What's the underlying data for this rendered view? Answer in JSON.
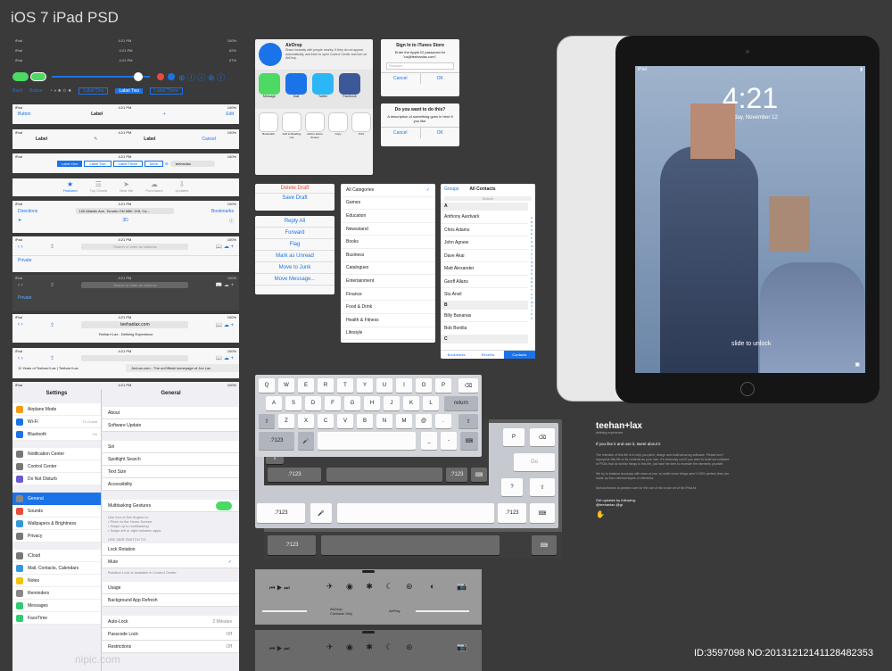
{
  "title": "iOS 7 iPad PSD",
  "status": {
    "carrier": "iPad",
    "time": "4:21 PM",
    "battery": "100%",
    "batteryB": "62%",
    "batteryC": "57%"
  },
  "nav1": {
    "back": "Back",
    "button": "Button",
    "seg": [
      "Label One",
      "Label Two",
      "Label Three"
    ]
  },
  "bar1": {
    "left": "Button",
    "center": "Label",
    "right": "Edit"
  },
  "bar2": {
    "label": "Label",
    "cancel": "Cancel"
  },
  "bar3": {
    "seg": [
      "Label One",
      "Label Two",
      "Label Three",
      "More"
    ],
    "search": "teehanlax"
  },
  "tabs": [
    "Featured",
    "Top Charts",
    "Near Me",
    "Purchased",
    "Updates"
  ],
  "maps": {
    "left": "Directions",
    "field": "100 Atlantic Ave, Toronto ON M6K 1X8, Ca...",
    "right": "Bookmarks",
    "mode": "3D"
  },
  "safari": {
    "placeholder": "Search or enter an address",
    "private": "Private",
    "domain": "teehanlax.com",
    "sitetitle": "Teehan+Lax : Defining Experience",
    "tab1": "11 Years of Teehan+Lax | Teehan+Lax",
    "tab2": "JonLax.com - The unOfficial homepage of Jon Lax"
  },
  "settings": {
    "title": "Settings",
    "items": [
      {
        "label": "Airplane Mode",
        "color": "#f39c12"
      },
      {
        "label": "Wi-Fi",
        "value": "TL-Guest",
        "color": "#1a73e8"
      },
      {
        "label": "Bluetooth",
        "value": "On",
        "color": "#1a73e8"
      },
      {
        "label": "Notification Center",
        "color": "#777"
      },
      {
        "label": "Control Center",
        "color": "#777"
      },
      {
        "label": "Do Not Disturb",
        "color": "#6a5acd"
      },
      {
        "label": "General",
        "color": "#888"
      },
      {
        "label": "Sounds",
        "color": "#e74c3c"
      },
      {
        "label": "Wallpapers & Brightness",
        "color": "#3498db"
      },
      {
        "label": "Privacy",
        "color": "#777"
      },
      {
        "label": "iCloud",
        "color": "#777"
      },
      {
        "label": "Mail, Contacts, Calendars",
        "color": "#3498db"
      },
      {
        "label": "Notes",
        "color": "#f1c40f"
      },
      {
        "label": "Reminders",
        "color": "#888"
      },
      {
        "label": "Messages",
        "color": "#2ecc71"
      },
      {
        "label": "FaceTime",
        "color": "#2ecc71"
      }
    ]
  },
  "general": {
    "title": "General",
    "about": "About",
    "update": "Software Update",
    "siri": "Siri",
    "spotlight": "Spotlight Search",
    "textsize": "Text Size",
    "access": "Accessibility",
    "multi": "Multitasking Gestures",
    "multidesc": [
      "Use four or five fingers to:",
      "• Pinch to the Home Screen",
      "• Swipe up to multitasking",
      "• Swipe left or right between apps"
    ],
    "sideswitch": "USE SIDE SWITCH TO:",
    "lock": "Lock Rotation",
    "mute": "Mute",
    "rotnote": "Rotation Lock is available in Control Center.",
    "usage": "Usage",
    "bgrefresh": "Background App Refresh",
    "autolock": "Auto-Lock",
    "autolockval": "2 Minutes",
    "passcode": "Passcode Lock",
    "passval": "Off",
    "restrict": "Restrictions",
    "restrictval": "Off"
  },
  "share": {
    "airdrop": "AirDrop",
    "airdesc": "Share instantly with people nearby. If they do not appear automatically, ask them to open Control Center and turn on AirDrop.",
    "apps": [
      "Message",
      "Mail",
      "Twitter",
      "Facebook"
    ],
    "acts": [
      "Bookmark",
      "Add to Reading List",
      "Add to Home Screen",
      "Copy",
      "Print"
    ]
  },
  "alert1": {
    "title": "Sign In to iTunes Store",
    "msg": "Enter the Apple ID password for \"us@teehanlax.com\".",
    "ph": "Password",
    "cancel": "Cancel",
    "ok": "OK"
  },
  "alert2": {
    "title": "Do you want to do this?",
    "msg": "A description of something goes in here if you like.",
    "cancel": "Cancel",
    "ok": "OK"
  },
  "draft": [
    "Delete Draft",
    "Save Draft"
  ],
  "mailact": [
    "Reply All",
    "Forward",
    "Flag",
    "Mark as Unread",
    "Move to Junk",
    "Move Message..."
  ],
  "cats": [
    "All Categories",
    "Games",
    "Education",
    "Newsstand",
    "Books",
    "Business",
    "Catalogues",
    "Entertainment",
    "Finance",
    "Food & Drink",
    "Health & Fitness",
    "Lifestyle"
  ],
  "contacts": {
    "groups": "Groups",
    "title": "All Contacts",
    "search": "Search",
    "rows": [
      "A",
      "Anthony Aardvark",
      "Chris Adams",
      "John Agnew",
      "Dave Akai",
      "Matt Alexander",
      "Geoff Allans",
      "Stu Anvil",
      "B",
      "Billy Bananas",
      "Bob Bonilla",
      "C"
    ],
    "tabs": [
      "Bookmarks",
      "Recents",
      "Contacts"
    ],
    "index": "A B C D E F G H I J K L M N O P Q R S T U V W X Y Z #"
  },
  "keyboard": {
    "r1": [
      "Q",
      "W",
      "E",
      "R",
      "T",
      "Y",
      "U",
      "I",
      "O",
      "P"
    ],
    "r2": [
      "A",
      "S",
      "D",
      "F",
      "G",
      "H",
      "J",
      "K",
      "L"
    ],
    "return": "return",
    "r3": [
      "Z",
      "X",
      "C",
      "V",
      "B",
      "N",
      "M",
      "@",
      "."
    ],
    "num": ".?123",
    "go": "Go",
    "num2": ".?123"
  },
  "cc": {
    "airdrop": "AirDrop:",
    "airdrop2": "Contacts Only",
    "airplay": "AirPlay"
  },
  "ipad": {
    "carrier": "iPad",
    "time": "4:21",
    "date": "Tuesday, November 12",
    "slide": "slide to unlock"
  },
  "brand": {
    "name": "teehan+lax",
    "sub": "defining experience",
    "like": "If you like it and use it, tweet about it",
    "p1": "The intention of this file is to help you pitch, design and build amazing software. Please don't repurpose this file or its contents as your own. It's obviously cool if you want to build out software or PSDs that do similar things to this file, just take the time to recreate the elements yourself.",
    "p2": "We try to balance accuracy with ease-of-use, so while some things aren't 100% perfect, they are made up from minimal layers or elements.",
    "p3": "Special thanks to pixeden.com for the use of his vector art of the iPad Air.",
    "get": "Get updates by following:",
    "handles": "@teehanlax  @gt"
  },
  "watermark": {
    "id": "ID:3597098 NO:20131212141128482353",
    "site": "nipic.com"
  }
}
